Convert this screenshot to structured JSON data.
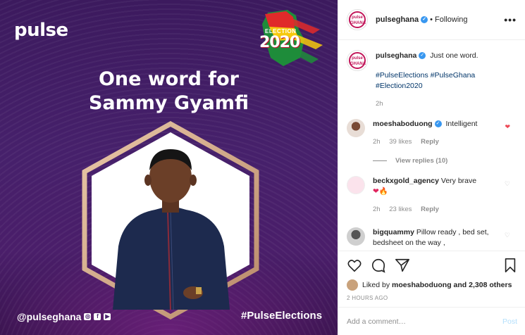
{
  "image": {
    "brand": "pulse",
    "badge_word": "ELECTION",
    "badge_year": "2020",
    "headline_line1": "One word for",
    "headline_line2": "Sammy Gyamfi",
    "footer_handle": "@pulseghana",
    "footer_hashtag": "#PulseElections"
  },
  "header": {
    "username": "pulseghana",
    "follow_status": "• Following",
    "more_icon": "more-horizontal-icon"
  },
  "caption": {
    "username": "pulseghana",
    "text": "Just one word.",
    "hashtags_line1": "#PulseElections #PulseGhana",
    "hashtags_line2": "#Election2020",
    "time": "2h"
  },
  "comments": [
    {
      "username": "moeshaboduong",
      "text": "Intelligent",
      "time": "2h",
      "likes": "39 likes",
      "reply": "Reply",
      "liked": true
    },
    {
      "username": "beckxgold_agency",
      "text": "Very brave",
      "emoji": "❤🔥",
      "time": "2h",
      "likes": "23 likes",
      "reply": "Reply",
      "liked": false
    },
    {
      "username": "bigquammy",
      "text": "Pillow ready , bed set, bedsheet on the way ,",
      "liked": false
    }
  ],
  "view_replies": "View replies (10)",
  "likes": {
    "prefix": "Liked by",
    "user": "moeshaboduong",
    "suffix": "and 2,308 others"
  },
  "timestamp": "2 HOURS AGO",
  "add_comment": {
    "placeholder": "Add a comment…",
    "post_label": "Post"
  },
  "colors": {
    "verified": "#3897f0",
    "liked_heart": "#ed4956",
    "image_bg": "#46206b",
    "post_button": "#b2dffc"
  }
}
